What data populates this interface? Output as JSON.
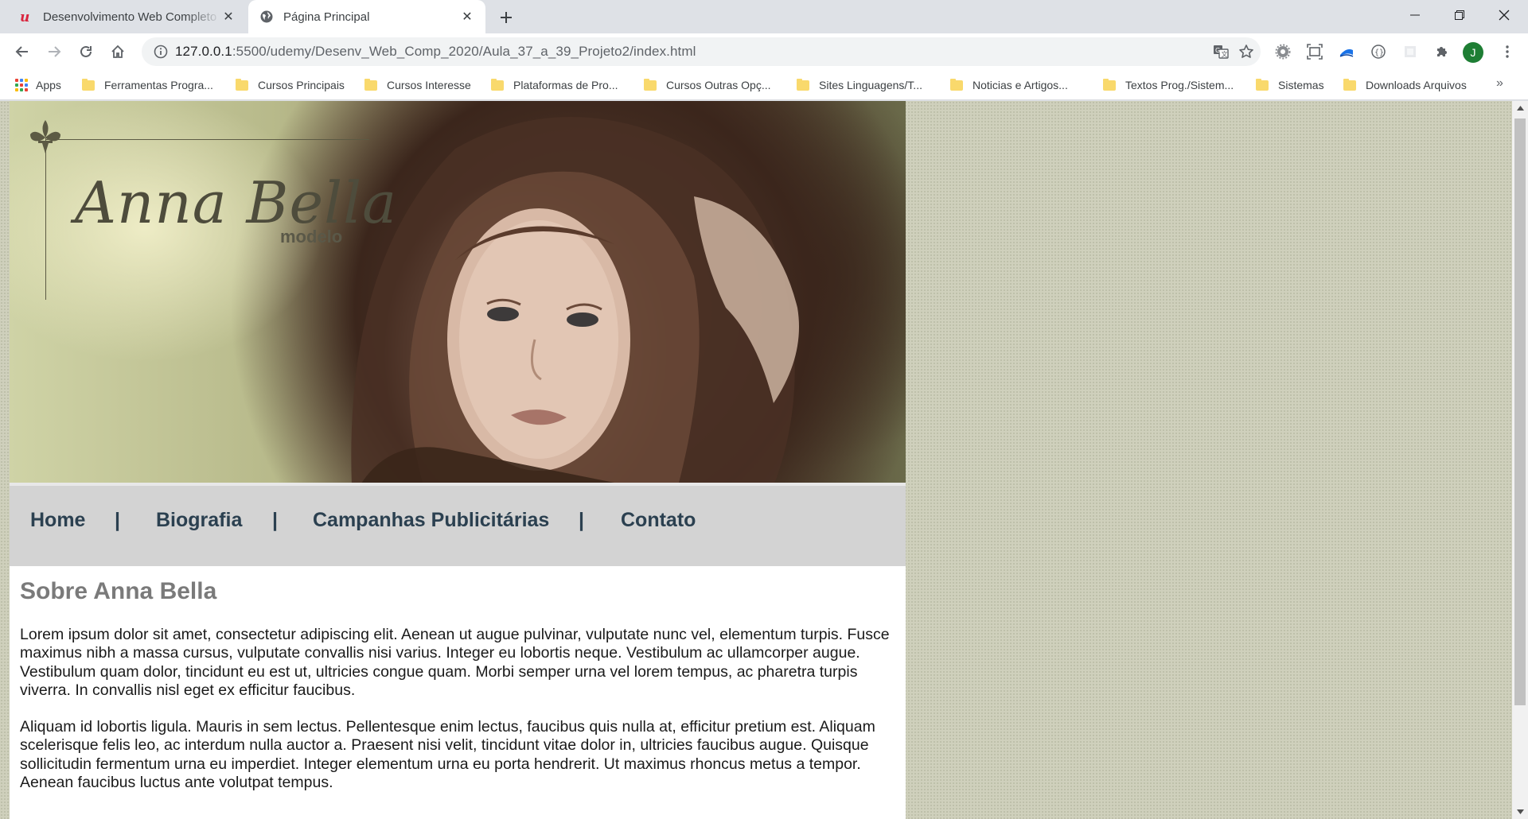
{
  "browser": {
    "tabs": [
      {
        "title": "Desenvolvimento Web Completo",
        "active": false,
        "favicon": "udemy-icon"
      },
      {
        "title": "Página Principal",
        "active": true,
        "favicon": "globe-icon"
      }
    ],
    "url": {
      "host": "127.0.0.1",
      "rest": ":5500/udemy/Desenv_Web_Comp_2020/Aula_37_a_39_Projeto2/index.html"
    },
    "profile_initial": "J",
    "bookmarks": [
      "Apps",
      "Ferramentas Progra...",
      "Cursos Principais",
      "Cursos Interesse",
      "Plataformas de Pro...",
      "Cursos Outras Opç...",
      "Sites Linguagens/T...",
      "Noticias e Artigos...",
      "Textos Prog./Sistem...",
      "Sistemas",
      "Downloads Arquivos"
    ],
    "bookmarks_more": "»",
    "colors": {
      "tab_bar": "#dee1e6",
      "avatar": "#1e7e34",
      "folder": "#f9d96c"
    }
  },
  "site": {
    "logo": {
      "name": "Anna Bella",
      "subtitle": "modelo"
    },
    "nav": {
      "items": [
        "Home",
        "Biografia",
        "Campanhas Publicitárias",
        "Contato"
      ],
      "separator": "|"
    },
    "heading": "Sobre Anna Bella",
    "paragraphs": [
      "Lorem ipsum dolor sit amet, consectetur adipiscing elit. Aenean ut augue pulvinar, vulputate nunc vel, elementum turpis. Fusce maximus nibh a massa cursus, vulputate convallis nisi varius. Integer eu lobortis neque. Vestibulum ac ullamcorper augue. Vestibulum quam dolor, tincidunt eu est ut, ultricies congue quam. Morbi semper urna vel lorem tempus, ac pharetra turpis viverra. In convallis nisl eget ex efficitur faucibus.",
      "Aliquam id lobortis ligula. Mauris in sem lectus. Pellentesque enim lectus, faucibus quis nulla at, efficitur pretium est. Aliquam scelerisque felis leo, ac interdum nulla auctor a. Praesent nisi velit, tincidunt vitae dolor in, ultricies faucibus augue. Quisque sollicitudin fermentum urna eu imperdiet. Integer elementum urna eu porta hendrerit. Ut maximus rhoncus metus a tempor. Aenean faucibus luctus ante volutpat tempus."
    ],
    "colors": {
      "nav_bg": "#d3d3d3",
      "nav_text": "#2b4050",
      "heading": "#7a7a7a",
      "page_bg": "#cfd0bc"
    }
  }
}
